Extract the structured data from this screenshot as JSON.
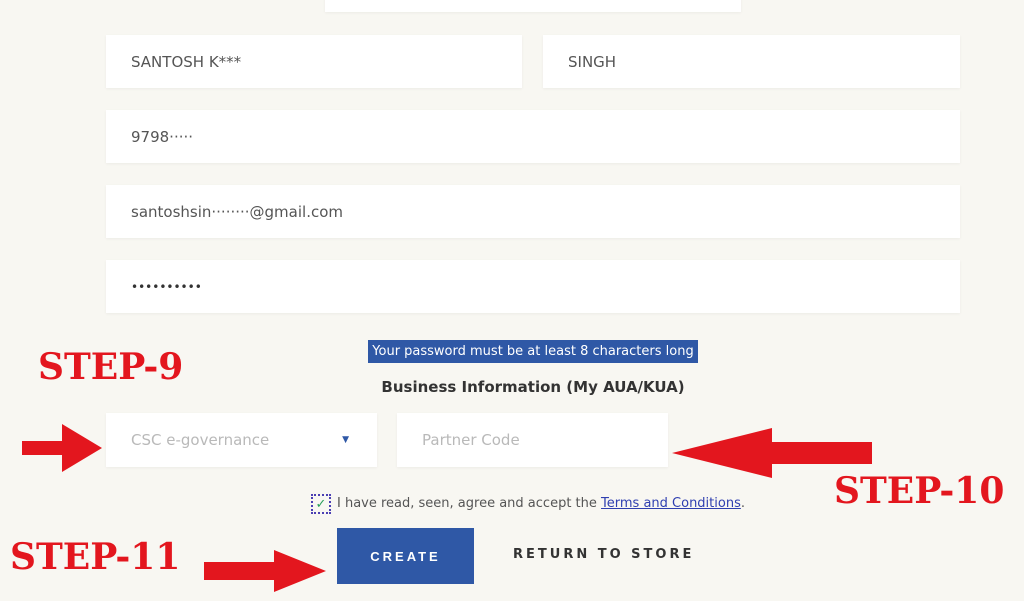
{
  "form": {
    "first_name": "SANTOSH K***",
    "last_name": "SINGH",
    "phone": "9798·····",
    "email": "santoshsin········@gmail.com",
    "password": "••••••••••",
    "password_hint": "Your password must be at least 8 characters long",
    "business_heading": "Business Information (My AUA/KUA)",
    "aua_select": "CSC e-governance",
    "partner_code_placeholder": "Partner Code",
    "terms_text": "I have read, seen, agree and accept the",
    "terms_link": "Terms and Conditions",
    "terms_period": ".",
    "checkbox_checked": true,
    "create_label": "CREATE",
    "return_label": "RETURN TO STORE"
  },
  "annotations": {
    "step9": "STEP-9",
    "step10": "STEP-10",
    "step11": "STEP-11",
    "arrow_color": "#e3161e"
  },
  "colors": {
    "accent": "#2f58a6",
    "background": "#f8f7f2"
  }
}
